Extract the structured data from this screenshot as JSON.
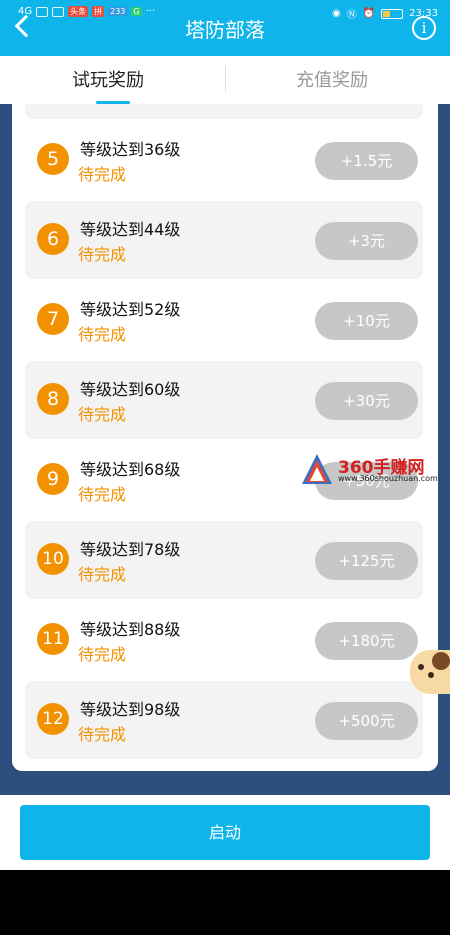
{
  "status_bar": {
    "time": "23:33",
    "network": "4G",
    "badges": [
      "头条",
      "拼",
      "233",
      "G"
    ]
  },
  "header": {
    "title": "塔防部落",
    "info_label": "i"
  },
  "tabs": [
    {
      "label": "试玩奖励",
      "active": true
    },
    {
      "label": "充值奖励",
      "active": false
    }
  ],
  "tasks": [
    {
      "num": "5",
      "title": "等级达到36级",
      "status": "待完成",
      "reward": "+1.5元"
    },
    {
      "num": "6",
      "title": "等级达到44级",
      "status": "待完成",
      "reward": "+3元"
    },
    {
      "num": "7",
      "title": "等级达到52级",
      "status": "待完成",
      "reward": "+10元"
    },
    {
      "num": "8",
      "title": "等级达到60级",
      "status": "待完成",
      "reward": "+30元"
    },
    {
      "num": "9",
      "title": "等级达到68级",
      "status": "待完成",
      "reward": "+50元"
    },
    {
      "num": "10",
      "title": "等级达到78级",
      "status": "待完成",
      "reward": "+125元"
    },
    {
      "num": "11",
      "title": "等级达到88级",
      "status": "待完成",
      "reward": "+180元"
    },
    {
      "num": "12",
      "title": "等级达到98级",
      "status": "待完成",
      "reward": "+500元"
    }
  ],
  "footer": {
    "start_label": "启动"
  },
  "watermark": {
    "title": "360手赚网",
    "url": "www.360shouzhuan.com"
  },
  "colors": {
    "primary": "#0fb5ea",
    "accent": "#f39200",
    "reward_button": "#c5c8c6"
  }
}
